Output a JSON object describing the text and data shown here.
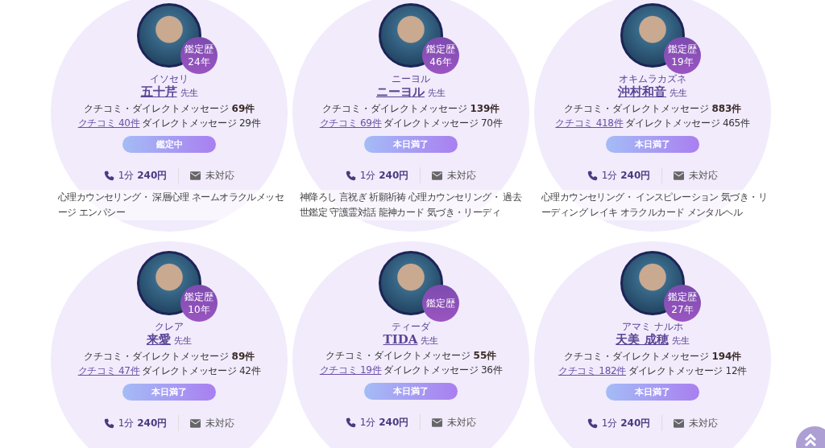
{
  "fortune_tellers": [
    {
      "badge_label": "鑑定歴",
      "badge_years": "24年",
      "furigana": "イソセリ",
      "name": "五十芹",
      "honorific": "先生",
      "total_reviews": "クチコミ・ダイレクトメッセージ **69件**",
      "reviews_link": "クチコミ 40件",
      "messages": "ダイレクトメッセージ 29件",
      "status": "鑑定中",
      "price": "1分 **240円**",
      "mail_status": "未対応",
      "specialties": "心理カウンセリング・ 深層心理 ネームオラクルメッセージ エンパシー"
    },
    {
      "badge_label": "鑑定歴",
      "badge_years": "46年",
      "furigana": "ニーヨル",
      "name": "ニーヨル",
      "honorific": "先生",
      "total_reviews": "クチコミ・ダイレクトメッセージ **139件**",
      "reviews_link": "クチコミ 69件",
      "messages": "ダイレクトメッセージ 70件",
      "status": "本日満了",
      "price": "1分 **240円**",
      "mail_status": "未対応",
      "specialties": "神降ろし 言祝ぎ 祈願祈祷 心理カウンセリング・ 過去世鑑定 守護霊対話 龍神カード 気づき・リーディ"
    },
    {
      "badge_label": "鑑定歴",
      "badge_years": "19年",
      "furigana": "オキムラカズネ",
      "name": "沖村和音",
      "honorific": "先生",
      "total_reviews": "クチコミ・ダイレクトメッセージ **883件**",
      "reviews_link": "クチコミ 418件",
      "messages": "ダイレクトメッセージ 465件",
      "status": "本日満了",
      "price": "1分 **240円**",
      "mail_status": "未対応",
      "specialties": "心理カウンセリング・ インスピレーション 気づき・リーディング レイキ オラクルカード メンタルヘル"
    },
    {
      "badge_label": "鑑定歴",
      "badge_years": "10年",
      "furigana": "クレア",
      "name": "来愛",
      "honorific": "先生",
      "total_reviews": "クチコミ・ダイレクトメッセージ **89件**",
      "reviews_link": "クチコミ 47件",
      "messages": "ダイレクトメッセージ 42件",
      "status": "本日満了",
      "price": "1分 **240円**",
      "mail_status": "未対応"
    },
    {
      "badge_label": "鑑定歴",
      "furigana": "ティーダ",
      "name": "TIDA",
      "honorific": "先生",
      "total_reviews": "クチコミ・ダイレクトメッセージ **55件**",
      "reviews_link": "クチコミ 19件",
      "messages": "ダイレクトメッセージ 36件",
      "status": "本日満了",
      "price": "1分 **240円**",
      "mail_status": "未対応"
    },
    {
      "badge_label": "鑑定歴",
      "badge_years": "27年",
      "furigana": "アマミ ナルホ",
      "name": "天美 成穂",
      "honorific": "先生",
      "total_reviews": "クチコミ・ダイレクトメッセージ **194件**",
      "reviews_link": "クチコミ 182件",
      "messages": "ダイレクトメッセージ 12件",
      "status": "本日満了",
      "price": "1分 **240円**",
      "mail_status": "未対応"
    }
  ]
}
